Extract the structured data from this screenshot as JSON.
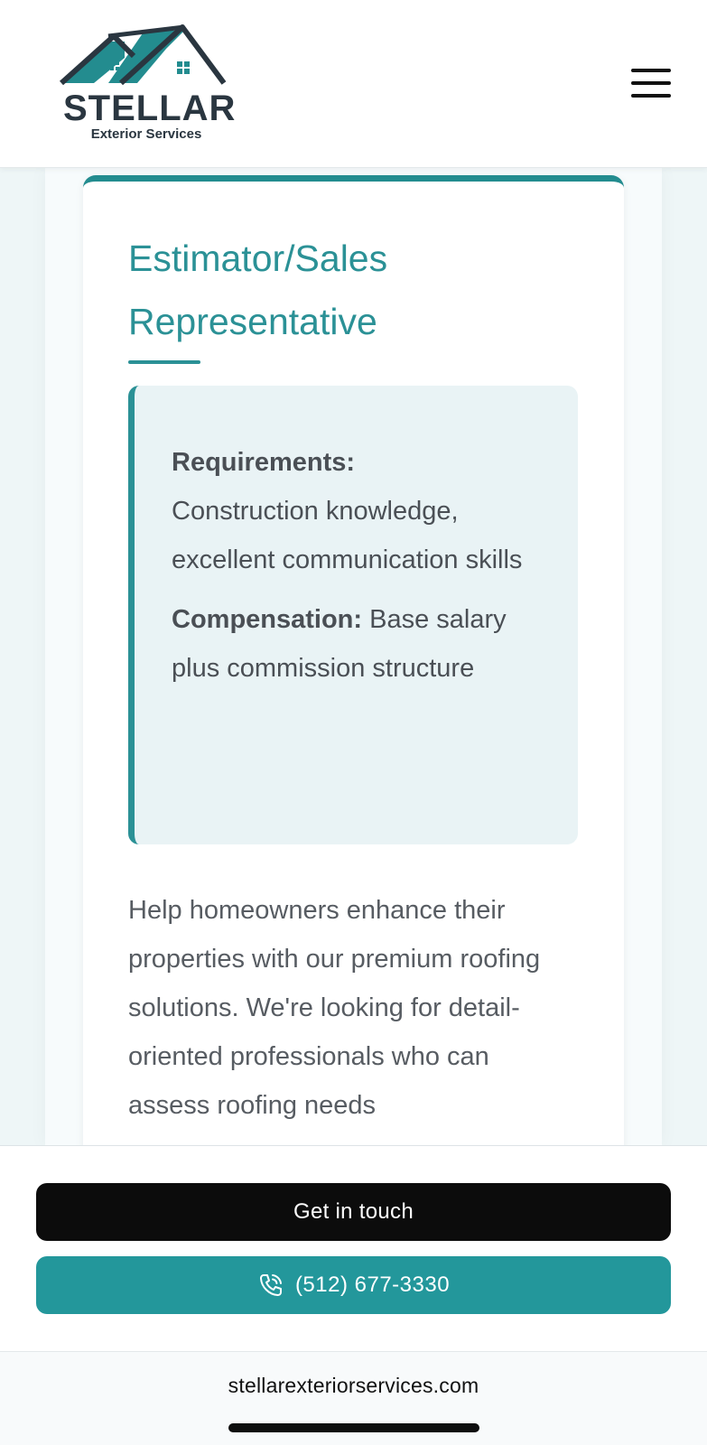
{
  "header": {
    "logo_word": "STELLAR",
    "logo_sub": "Exterior Services",
    "menu_icon": "hamburger-menu-icon"
  },
  "job": {
    "title_line1": "Estimator/Sales",
    "title_line2": "Representative",
    "requirements_label": "Requirements:",
    "requirements_text": "Construction knowledge, excellent communication skills",
    "compensation_label": "Compensation:",
    "compensation_text": "Base salary plus commission structure",
    "description": "Help homeowners enhance their properties with our premium roofing solutions. We're looking for detail-oriented professionals who can assess roofing needs"
  },
  "cta": {
    "primary_label": "Get in touch",
    "phone_label": "(512) 677-3330",
    "phone_icon": "phone-call-icon"
  },
  "browser": {
    "url": "stellarexteriorservices.com"
  },
  "colors": {
    "accent": "#2b9196",
    "button_phone": "#23979b",
    "button_primary": "#0c0c0c",
    "logo_dark": "#2a3640"
  }
}
